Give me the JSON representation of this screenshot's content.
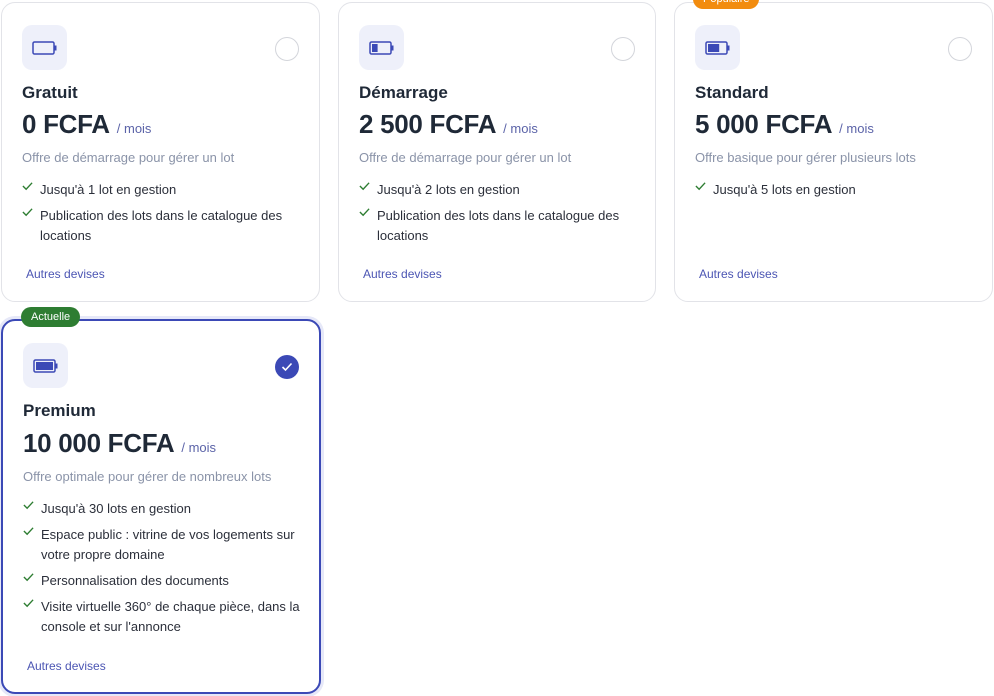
{
  "colors": {
    "accent": "#3b49b6",
    "popular_badge": "#f28c0f",
    "current_badge": "#2e7d32",
    "check": "#2e7d32"
  },
  "plans": [
    {
      "name": "Gratuit",
      "price": "0 FCFA",
      "per": "/ mois",
      "description": "Offre de démarrage pour gérer un lot",
      "icon": "battery-empty-icon",
      "battery_level": 0,
      "selected": false,
      "features": [
        "Jusqu'à 1 lot en gestion",
        "Publication des lots dans le catalogue des locations"
      ],
      "other_currencies": "Autres devises"
    },
    {
      "name": "Démarrage",
      "price": "2 500 FCFA",
      "per": "/ mois",
      "description": "Offre de démarrage pour gérer un lot",
      "icon": "battery-low-icon",
      "battery_level": 0.33,
      "selected": false,
      "features": [
        "Jusqu'à 2 lots en gestion",
        "Publication des lots dans le catalogue des locations"
      ],
      "other_currencies": "Autres devises"
    },
    {
      "name": "Standard",
      "price": "5 000 FCFA",
      "per": "/ mois",
      "description": "Offre basique pour gérer plusieurs lots",
      "icon": "battery-medium-icon",
      "battery_level": 0.66,
      "selected": false,
      "badge": "Populaire",
      "features": [
        "Jusqu'à 5 lots en gestion"
      ],
      "other_currencies": "Autres devises"
    },
    {
      "name": "Premium",
      "price": "10 000 FCFA",
      "per": "/ mois",
      "description": "Offre optimale pour gérer de nombreux lots",
      "icon": "battery-full-icon",
      "battery_level": 1,
      "selected": true,
      "badge": "Actuelle",
      "features": [
        "Jusqu'à 30 lots en gestion",
        "Espace public : vitrine de vos logements sur votre propre domaine",
        "Personnalisation des documents",
        "Visite virtuelle 360° de chaque pièce, dans la console et sur l'annonce"
      ],
      "other_currencies": "Autres devises"
    }
  ]
}
